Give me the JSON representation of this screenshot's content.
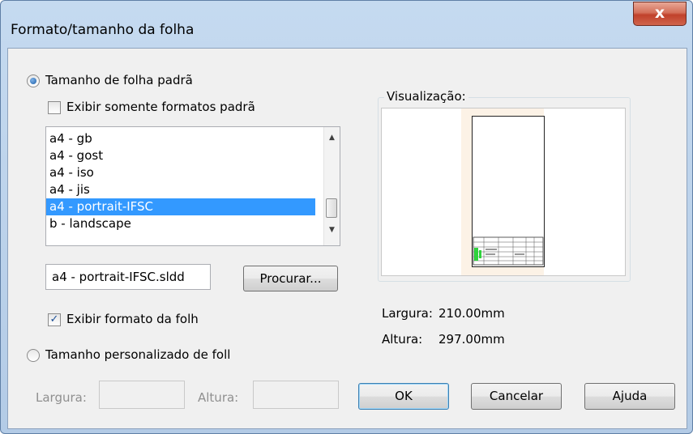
{
  "dialog": {
    "title": "Formato/tamanho da folha",
    "close_glyph": "x"
  },
  "standard": {
    "radio_label": "Tamanho de folha padrã",
    "radio_checked": true,
    "only_standard_label": "Exibir somente formatos padrã",
    "only_standard_checked": false,
    "list_items": [
      "a4 - gb",
      "a4 - gost",
      "a4 - iso",
      "a4 - jis",
      "a4 - portrait-IFSC",
      "b - landscape"
    ],
    "selected_item": "a4 - portrait-IFSC",
    "file_value": "a4 - portrait-IFSC.sldd",
    "browse_label": "Procurar...",
    "show_format_label": "Exibir formato da folh",
    "show_format_checked": true
  },
  "preview": {
    "label": "Visualização:",
    "width_label": "Largura:",
    "width_value": "210.00mm",
    "height_label": "Altura:",
    "height_value": "297.00mm"
  },
  "custom": {
    "radio_label": "Tamanho personalizado de foll",
    "radio_checked": false,
    "width_label": "Largura:",
    "width_value": "",
    "height_label": "Altura:",
    "height_value": ""
  },
  "buttons": {
    "ok": "OK",
    "cancel": "Cancelar",
    "help": "Ajuda"
  },
  "icons": {
    "close": "close-icon",
    "scroll_up": "scroll-up-arrow-icon",
    "scroll_down": "scroll-down-arrow-icon",
    "checkmark": "checkmark-icon"
  },
  "colors": {
    "selection": "#3399ff",
    "close_button": "#c0412b",
    "sheet_background": "#fcf2e6",
    "title_block_accent": "#2fd33c"
  }
}
